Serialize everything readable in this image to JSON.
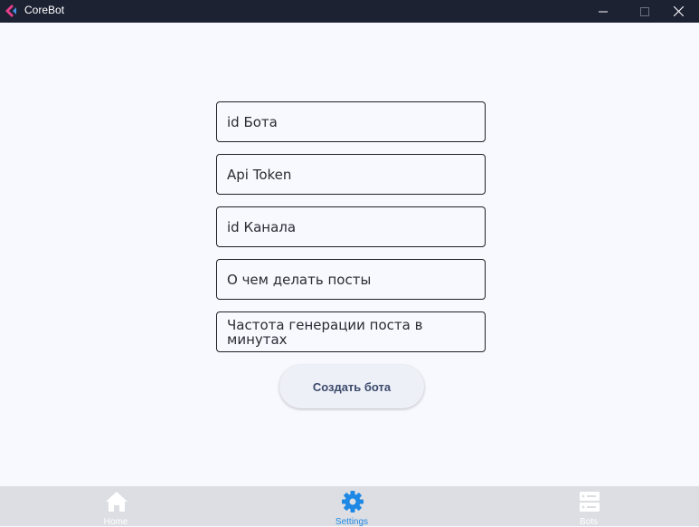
{
  "window": {
    "title": "CoreBot"
  },
  "form": {
    "fields": [
      {
        "label": "id Бота"
      },
      {
        "label": "Api Token"
      },
      {
        "label": "id Канала"
      },
      {
        "label": "О чем делать посты"
      },
      {
        "label": "Частота генерации поста в минутах"
      }
    ],
    "submit_label": "Создать бота"
  },
  "bottom_nav": {
    "items": [
      {
        "label": "Home",
        "icon": "home-icon",
        "active": false
      },
      {
        "label": "Settings",
        "icon": "gear-icon",
        "active": true
      },
      {
        "label": "Bots",
        "icon": "server-icon",
        "active": false
      }
    ],
    "active_color": "#1e88e5"
  }
}
